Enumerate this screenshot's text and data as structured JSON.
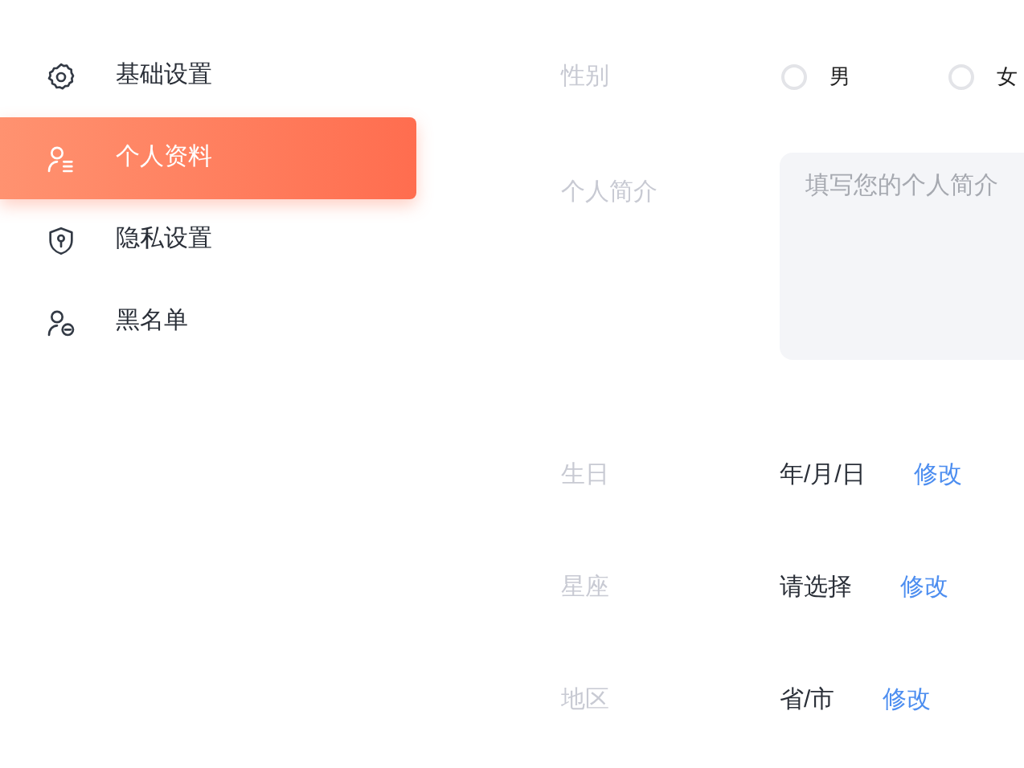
{
  "sidebar": {
    "items": [
      {
        "label": "基础设置",
        "selected": false
      },
      {
        "label": "个人资料",
        "selected": true
      },
      {
        "label": "隐私设置",
        "selected": false
      },
      {
        "label": "黑名单",
        "selected": false
      }
    ]
  },
  "form": {
    "gender": {
      "label": "性别",
      "options": [
        {
          "label": "男",
          "selected": false
        },
        {
          "label": "女",
          "selected": false
        }
      ]
    },
    "bio": {
      "label": "个人简介",
      "placeholder": "填写您的个人简介"
    },
    "fields": [
      {
        "label": "生日",
        "value": "年/月/日",
        "action": "修改"
      },
      {
        "label": "星座",
        "value": "请选择",
        "action": "修改"
      },
      {
        "label": "地区",
        "value": "省/市",
        "action": "修改"
      }
    ]
  }
}
